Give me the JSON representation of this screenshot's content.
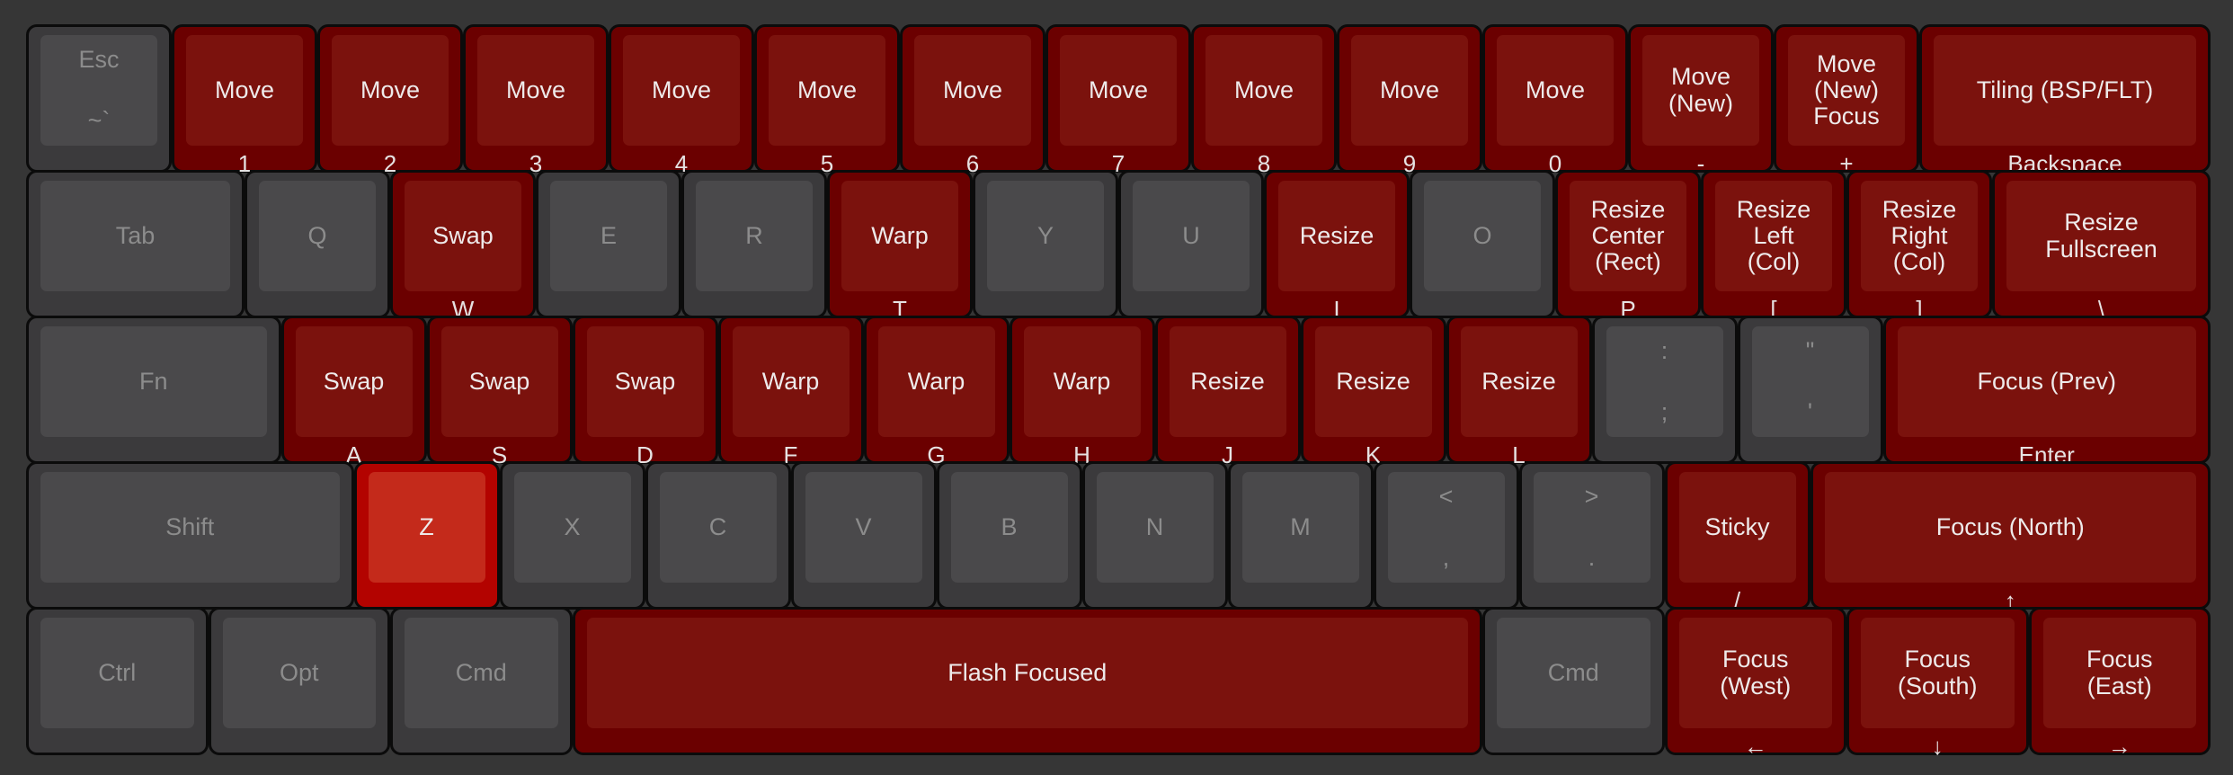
{
  "colors": {
    "background": "#363636",
    "inactive_key": "#4a494b",
    "bound_key": "#7b120d",
    "highlighted_key": "#c42a1b",
    "label_inactive": "#8c8c8c",
    "label_active": "#eeeaea"
  },
  "rows": [
    [
      {
        "top": "Esc",
        "bottom": "~`",
        "w": 1,
        "style": "gray"
      },
      {
        "label": "Move",
        "sub": "1",
        "w": 1,
        "style": "red"
      },
      {
        "label": "Move",
        "sub": "2",
        "w": 1,
        "style": "red"
      },
      {
        "label": "Move",
        "sub": "3",
        "w": 1,
        "style": "red"
      },
      {
        "label": "Move",
        "sub": "4",
        "w": 1,
        "style": "red"
      },
      {
        "label": "Move",
        "sub": "5",
        "w": 1,
        "style": "red"
      },
      {
        "label": "Move",
        "sub": "6",
        "w": 1,
        "style": "red"
      },
      {
        "label": "Move",
        "sub": "7",
        "w": 1,
        "style": "red"
      },
      {
        "label": "Move",
        "sub": "8",
        "w": 1,
        "style": "red"
      },
      {
        "label": "Move",
        "sub": "9",
        "w": 1,
        "style": "red"
      },
      {
        "label": "Move",
        "sub": "0",
        "w": 1,
        "style": "red"
      },
      {
        "label": "Move\n(New)",
        "sub": "-",
        "w": 1,
        "style": "red"
      },
      {
        "label": "Move\n(New)\nFocus",
        "sub": "+",
        "w": 1,
        "style": "red"
      },
      {
        "label": "Tiling (BSP/FLT)",
        "sub": "Backspace",
        "w": 2,
        "style": "red"
      }
    ],
    [
      {
        "label": "Tab",
        "w": 1.5,
        "style": "gray"
      },
      {
        "label": "Q",
        "w": 1,
        "style": "gray"
      },
      {
        "label": "Swap",
        "sub": "W",
        "w": 1,
        "style": "red"
      },
      {
        "label": "E",
        "w": 1,
        "style": "gray"
      },
      {
        "label": "R",
        "w": 1,
        "style": "gray"
      },
      {
        "label": "Warp",
        "sub": "T",
        "w": 1,
        "style": "red"
      },
      {
        "label": "Y",
        "w": 1,
        "style": "gray"
      },
      {
        "label": "U",
        "w": 1,
        "style": "gray"
      },
      {
        "label": "Resize",
        "sub": "I",
        "w": 1,
        "style": "red"
      },
      {
        "label": "O",
        "w": 1,
        "style": "gray"
      },
      {
        "label": "Resize\nCenter\n(Rect)",
        "sub": "P",
        "w": 1,
        "style": "red"
      },
      {
        "label": "Resize\nLeft\n(Col)",
        "sub": "[",
        "w": 1,
        "style": "red"
      },
      {
        "label": "Resize\nRight\n(Col)",
        "sub": "]",
        "w": 1,
        "style": "red"
      },
      {
        "label": "Resize\nFullscreen",
        "sub": "\\",
        "w": 1.5,
        "style": "red"
      }
    ],
    [
      {
        "label": "Fn",
        "w": 1.75,
        "style": "gray"
      },
      {
        "label": "Swap",
        "sub": "A",
        "w": 1,
        "style": "red"
      },
      {
        "label": "Swap",
        "sub": "S",
        "w": 1,
        "style": "red"
      },
      {
        "label": "Swap",
        "sub": "D",
        "w": 1,
        "style": "red"
      },
      {
        "label": "Warp",
        "sub": "F",
        "w": 1,
        "style": "red"
      },
      {
        "label": "Warp",
        "sub": "G",
        "w": 1,
        "style": "red"
      },
      {
        "label": "Warp",
        "sub": "H",
        "w": 1,
        "style": "red"
      },
      {
        "label": "Resize",
        "sub": "J",
        "w": 1,
        "style": "red"
      },
      {
        "label": "Resize",
        "sub": "K",
        "w": 1,
        "style": "red"
      },
      {
        "label": "Resize",
        "sub": "L",
        "w": 1,
        "style": "red"
      },
      {
        "top": ":",
        "bottom": ";",
        "w": 1,
        "style": "gray"
      },
      {
        "top": "\"",
        "bottom": "'",
        "w": 1,
        "style": "gray"
      },
      {
        "label": "Focus (Prev)",
        "sub": "Enter",
        "w": 2.25,
        "style": "red"
      }
    ],
    [
      {
        "label": "Shift",
        "w": 2.25,
        "style": "gray"
      },
      {
        "label": "Z",
        "w": 1,
        "style": "hot"
      },
      {
        "label": "X",
        "w": 1,
        "style": "gray"
      },
      {
        "label": "C",
        "w": 1,
        "style": "gray"
      },
      {
        "label": "V",
        "w": 1,
        "style": "gray"
      },
      {
        "label": "B",
        "w": 1,
        "style": "gray"
      },
      {
        "label": "N",
        "w": 1,
        "style": "gray"
      },
      {
        "label": "M",
        "w": 1,
        "style": "gray"
      },
      {
        "top": "<",
        "bottom": ",",
        "w": 1,
        "style": "gray"
      },
      {
        "top": ">",
        "bottom": ".",
        "w": 1,
        "style": "gray"
      },
      {
        "label": "Sticky",
        "sub": "/",
        "w": 1,
        "style": "red"
      },
      {
        "label": "Focus (North)",
        "sub": "↑",
        "w": 2.75,
        "style": "red"
      }
    ],
    [
      {
        "label": "Ctrl",
        "w": 1.25,
        "style": "gray"
      },
      {
        "label": "Opt",
        "w": 1.25,
        "style": "gray"
      },
      {
        "label": "Cmd",
        "w": 1.25,
        "style": "gray"
      },
      {
        "label": "Flash Focused",
        "w": 6.25,
        "style": "red"
      },
      {
        "label": "Cmd",
        "w": 1.25,
        "style": "gray"
      },
      {
        "label": "Focus\n(West)",
        "sub": "←",
        "w": 1.25,
        "style": "red"
      },
      {
        "label": "Focus\n(South)",
        "sub": "↓",
        "w": 1.25,
        "style": "red"
      },
      {
        "label": "Focus\n(East)",
        "sub": "→",
        "w": 1.25,
        "style": "red"
      }
    ]
  ]
}
